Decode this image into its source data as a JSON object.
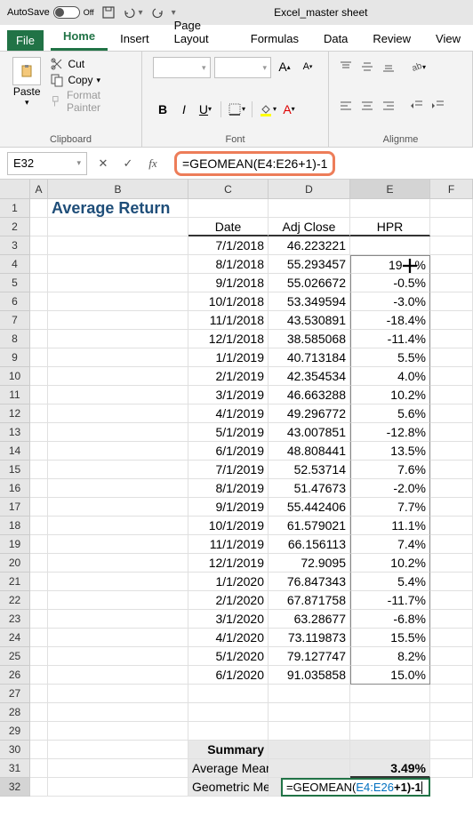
{
  "titlebar": {
    "autosave_label": "AutoSave",
    "autosave_state": "Off",
    "app_title": "Excel_master sheet"
  },
  "tabs": {
    "file": "File",
    "home": "Home",
    "insert": "Insert",
    "page_layout": "Page Layout",
    "formulas": "Formulas",
    "data": "Data",
    "review": "Review",
    "view": "View"
  },
  "ribbon": {
    "clipboard": {
      "paste": "Paste",
      "cut": "Cut",
      "copy": "Copy",
      "format_painter": "Format Painter",
      "label": "Clipboard"
    },
    "font": {
      "label": "Font",
      "bold": "B",
      "italic": "I",
      "underline": "U"
    },
    "alignment": {
      "label": "Alignme"
    }
  },
  "formula_bar": {
    "name_box": "E32",
    "formula": "=GEOMEAN(E4:E26+1)-1"
  },
  "columns": [
    "A",
    "B",
    "C",
    "D",
    "E",
    "F"
  ],
  "sheet": {
    "title": "Average Return",
    "headers": {
      "date": "Date",
      "adj_close": "Adj Close",
      "hpr": "HPR"
    },
    "rows": [
      {
        "r": 3,
        "date": "7/1/2018",
        "close": "46.223221",
        "hpr": ""
      },
      {
        "r": 4,
        "date": "8/1/2018",
        "close": "55.293457",
        "hpr": "19.6%"
      },
      {
        "r": 5,
        "date": "9/1/2018",
        "close": "55.026672",
        "hpr": "-0.5%"
      },
      {
        "r": 6,
        "date": "10/1/2018",
        "close": "53.349594",
        "hpr": "-3.0%"
      },
      {
        "r": 7,
        "date": "11/1/2018",
        "close": "43.530891",
        "hpr": "-18.4%"
      },
      {
        "r": 8,
        "date": "12/1/2018",
        "close": "38.585068",
        "hpr": "-11.4%"
      },
      {
        "r": 9,
        "date": "1/1/2019",
        "close": "40.713184",
        "hpr": "5.5%"
      },
      {
        "r": 10,
        "date": "2/1/2019",
        "close": "42.354534",
        "hpr": "4.0%"
      },
      {
        "r": 11,
        "date": "3/1/2019",
        "close": "46.663288",
        "hpr": "10.2%"
      },
      {
        "r": 12,
        "date": "4/1/2019",
        "close": "49.296772",
        "hpr": "5.6%"
      },
      {
        "r": 13,
        "date": "5/1/2019",
        "close": "43.007851",
        "hpr": "-12.8%"
      },
      {
        "r": 14,
        "date": "6/1/2019",
        "close": "48.808441",
        "hpr": "13.5%"
      },
      {
        "r": 15,
        "date": "7/1/2019",
        "close": "52.53714",
        "hpr": "7.6%"
      },
      {
        "r": 16,
        "date": "8/1/2019",
        "close": "51.47673",
        "hpr": "-2.0%"
      },
      {
        "r": 17,
        "date": "9/1/2019",
        "close": "55.442406",
        "hpr": "7.7%"
      },
      {
        "r": 18,
        "date": "10/1/2019",
        "close": "61.579021",
        "hpr": "11.1%"
      },
      {
        "r": 19,
        "date": "11/1/2019",
        "close": "66.156113",
        "hpr": "7.4%"
      },
      {
        "r": 20,
        "date": "12/1/2019",
        "close": "72.9095",
        "hpr": "10.2%"
      },
      {
        "r": 21,
        "date": "1/1/2020",
        "close": "76.847343",
        "hpr": "5.4%"
      },
      {
        "r": 22,
        "date": "2/1/2020",
        "close": "67.871758",
        "hpr": "-11.7%"
      },
      {
        "r": 23,
        "date": "3/1/2020",
        "close": "63.28677",
        "hpr": "-6.8%"
      },
      {
        "r": 24,
        "date": "4/1/2020",
        "close": "73.119873",
        "hpr": "15.5%"
      },
      {
        "r": 25,
        "date": "5/1/2020",
        "close": "79.127747",
        "hpr": "8.2%"
      },
      {
        "r": 26,
        "date": "6/1/2020",
        "close": "91.035858",
        "hpr": "15.0%"
      }
    ],
    "summary": {
      "title": "Summary",
      "avg_label": "Average Mean Return",
      "avg_value": "3.49%",
      "geo_label": "Geometric Me",
      "geo_formula_prefix": "=GEOMEAN(",
      "geo_formula_ref": "E4:E26",
      "geo_formula_suffix": "+1)-1"
    }
  }
}
